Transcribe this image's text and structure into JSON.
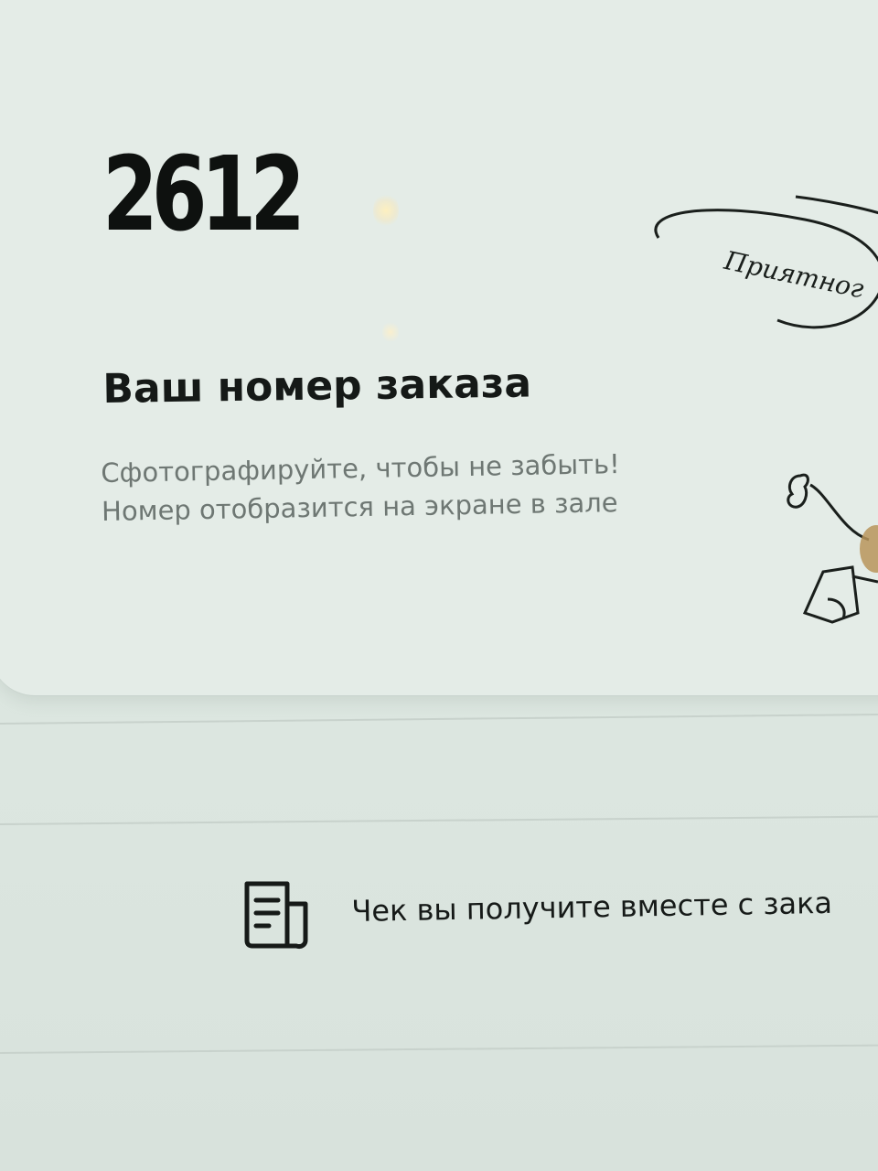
{
  "order": {
    "number": "2612",
    "heading": "Ваш номер заказа",
    "hint_line1": "Сфотографируйте, чтобы не забыть!",
    "hint_line2": "Номер отобразится на экране в зале"
  },
  "decoration": {
    "greeting_text": "Приятног"
  },
  "receipt": {
    "icon": "receipt-icon",
    "text": "Чек вы получите вместе с зака"
  },
  "colors": {
    "background": "#dfe8e3",
    "text_primary": "#141816",
    "text_secondary": "#6e7773"
  }
}
